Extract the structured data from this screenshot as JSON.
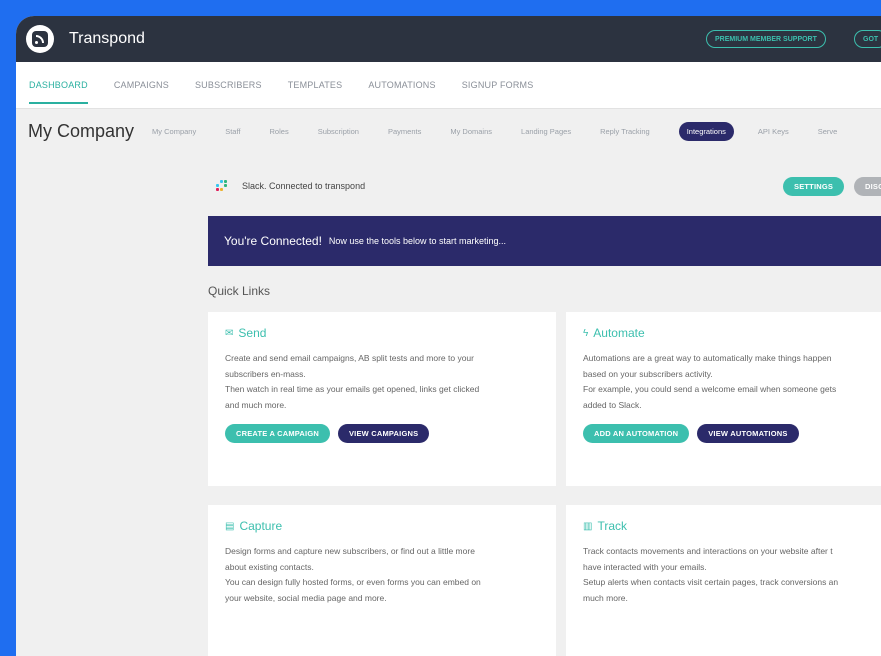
{
  "app": {
    "name": "Transpond"
  },
  "topbar": {
    "premium_support": "PREMIUM MEMBER SUPPORT",
    "got_label": "GOT"
  },
  "nav": {
    "items": [
      {
        "label": "DASHBOARD",
        "active": true
      },
      {
        "label": "CAMPAIGNS"
      },
      {
        "label": "SUBSCRIBERS"
      },
      {
        "label": "TEMPLATES"
      },
      {
        "label": "AUTOMATIONS"
      },
      {
        "label": "SIGNUP FORMS"
      }
    ]
  },
  "subnav": {
    "title": "My Company",
    "items": [
      {
        "label": "My Company"
      },
      {
        "label": "Staff"
      },
      {
        "label": "Roles"
      },
      {
        "label": "Subscription"
      },
      {
        "label": "Payments"
      },
      {
        "label": "My Domains"
      },
      {
        "label": "Landing Pages"
      },
      {
        "label": "Reply Tracking"
      },
      {
        "label": "Integrations",
        "active": true
      },
      {
        "label": "API Keys"
      },
      {
        "label": "Serve"
      }
    ]
  },
  "integration": {
    "status_text": "Slack. Connected to transpond",
    "settings_label": "SETTINGS",
    "disconnect_label": "DISCON"
  },
  "banner": {
    "headline": "You're Connected!",
    "text": "Now use the tools below to start marketing..."
  },
  "quick_links": {
    "heading": "Quick Links",
    "cards": [
      {
        "title": "Send",
        "icon": "envelope-icon",
        "lines": [
          "Create and send email campaigns, AB split tests and more to your",
          "subscribers en-mass.",
          "Then watch in real time as your emails get opened, links get clicked",
          "and much more."
        ],
        "primary": "CREATE A CAMPAIGN",
        "secondary": "VIEW CAMPAIGNS"
      },
      {
        "title": "Automate",
        "icon": "lightning-icon",
        "lines": [
          "Automations are a great way to automatically make things happen",
          "based on your subscribers activity.",
          "For example, you could send a welcome email when someone gets",
          "added to Slack."
        ],
        "primary": "ADD AN AUTOMATION",
        "secondary": "VIEW AUTOMATIONS"
      },
      {
        "title": "Capture",
        "icon": "form-icon",
        "lines": [
          "Design forms and capture new subscribers, or find out a little more",
          "about existing contacts.",
          "You can design fully hosted forms, or even forms you can embed on",
          "your website, social media page and more."
        ]
      },
      {
        "title": "Track",
        "icon": "chart-icon",
        "lines": [
          "Track contacts movements and interactions on your website after t",
          "have interacted with your emails.",
          "Setup alerts when contacts visit certain pages, track conversions an",
          "much more."
        ]
      }
    ]
  },
  "colors": {
    "accent": "#3cbfae",
    "navy": "#2b2a6a",
    "topbar": "#2c3340",
    "frame": "#1f6ef0"
  }
}
